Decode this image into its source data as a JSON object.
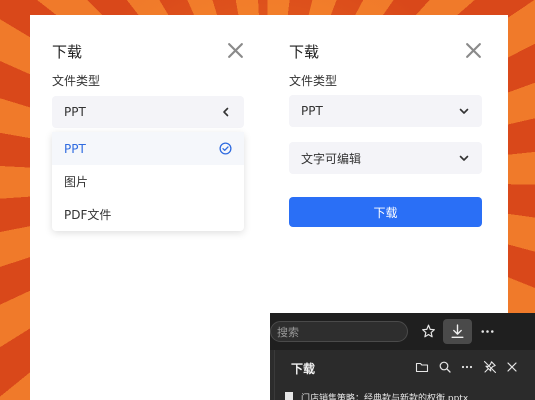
{
  "left_dialog": {
    "title": "下载",
    "file_type_label": "文件类型",
    "select_value": "PPT",
    "options": [
      {
        "label": "PPT",
        "selected": true
      },
      {
        "label": "图片",
        "selected": false
      },
      {
        "label": "PDF文件",
        "selected": false
      }
    ]
  },
  "right_dialog": {
    "title": "下载",
    "file_type_label": "文件类型",
    "select_value": "PPT",
    "edit_mode_value": "文字可编辑",
    "download_button": "下载"
  },
  "browser": {
    "search_placeholder": "搜索",
    "downloads_title": "下载",
    "file_name": "门店销售策略：经典款与新款的权衡.pptx"
  },
  "colors": {
    "accent": "#2a6ff6",
    "selected_text": "#2f6be0",
    "select_bg": "#f4f4f8",
    "background_orange": "#e8531c"
  },
  "icons": {
    "close": "close-icon",
    "chevron_left": "chevron-left-icon",
    "chevron_down": "chevron-down-icon",
    "check": "check-circle-icon"
  }
}
